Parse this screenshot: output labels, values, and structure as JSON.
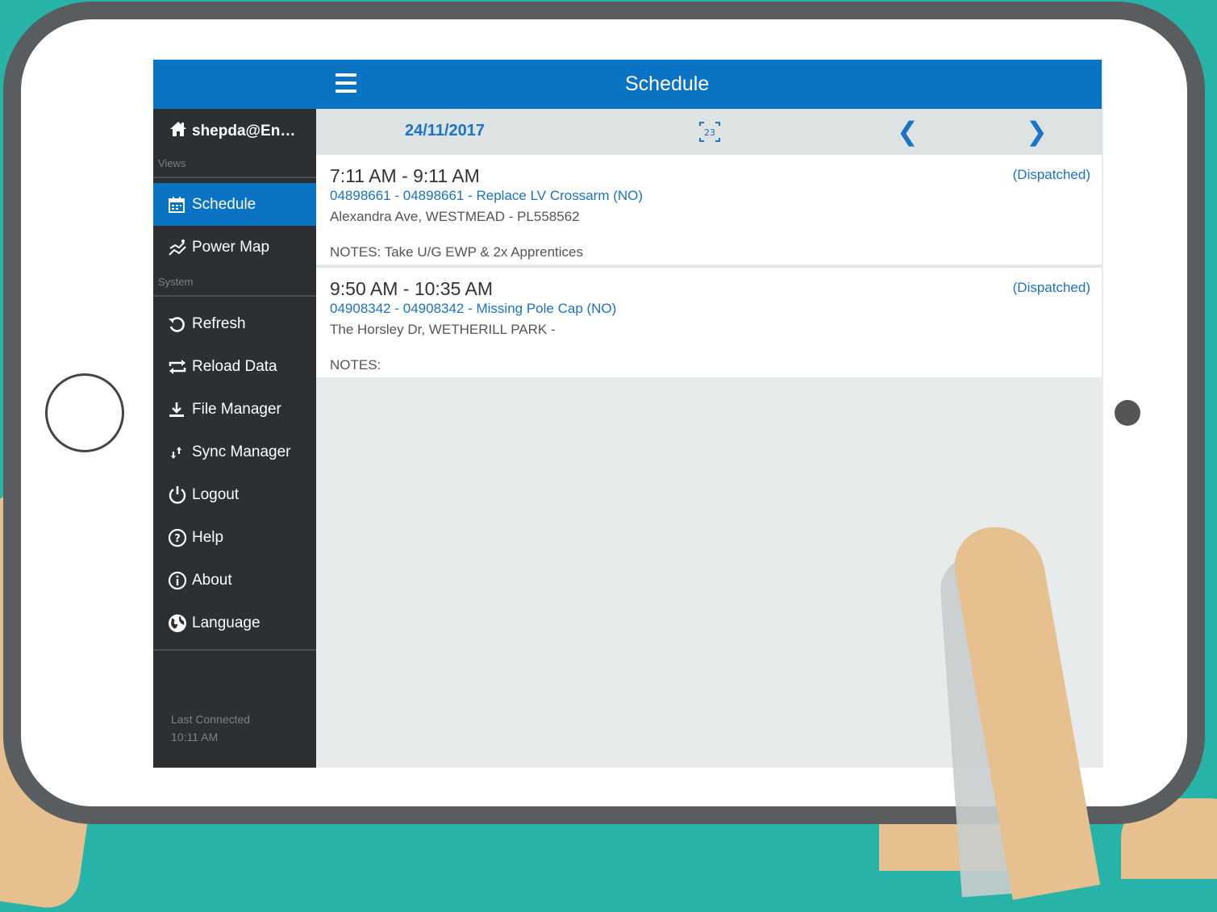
{
  "header": {
    "title": "Schedule"
  },
  "sidebar": {
    "user": "shepda@En…",
    "views_label": "Views",
    "system_label": "System",
    "views": [
      {
        "label": "Schedule",
        "icon": "calendar-icon",
        "active": true
      },
      {
        "label": "Power Map",
        "icon": "power-map-icon",
        "active": false
      }
    ],
    "system": [
      {
        "label": "Refresh",
        "icon": "refresh-icon"
      },
      {
        "label": "Reload Data",
        "icon": "reload-icon"
      },
      {
        "label": "File Manager",
        "icon": "download-icon"
      },
      {
        "label": "Sync Manager",
        "icon": "sync-icon"
      },
      {
        "label": "Logout",
        "icon": "power-icon"
      },
      {
        "label": "Help",
        "icon": "help-icon"
      },
      {
        "label": "About",
        "icon": "info-icon"
      },
      {
        "label": "Language",
        "icon": "globe-icon"
      }
    ],
    "last_connected_label": "Last Connected",
    "last_connected_time": "10:11 AM"
  },
  "datebar": {
    "date": "24/11/2017",
    "calendar_day": "23",
    "prev": "❮",
    "next": "❯"
  },
  "jobs": [
    {
      "time": "7:11 AM - 9:11 AM",
      "status": "(Dispatched)",
      "title": "04898661 - 04898661 - Replace LV Crossarm (NO)",
      "address": "Alexandra Ave, WESTMEAD - PL558562",
      "notes": "NOTES: Take U/G EWP & 2x Apprentices"
    },
    {
      "time": "9:50 AM - 10:35 AM",
      "status": "(Dispatched)",
      "title": "04908342 - 04908342 - Missing Pole Cap (NO)",
      "address": "The Horsley Dr, WETHERILL PARK -",
      "notes": "NOTES:"
    }
  ],
  "colors": {
    "accent": "#0a73c4",
    "sidebar": "#2c3032",
    "background": "#27b3a7"
  }
}
